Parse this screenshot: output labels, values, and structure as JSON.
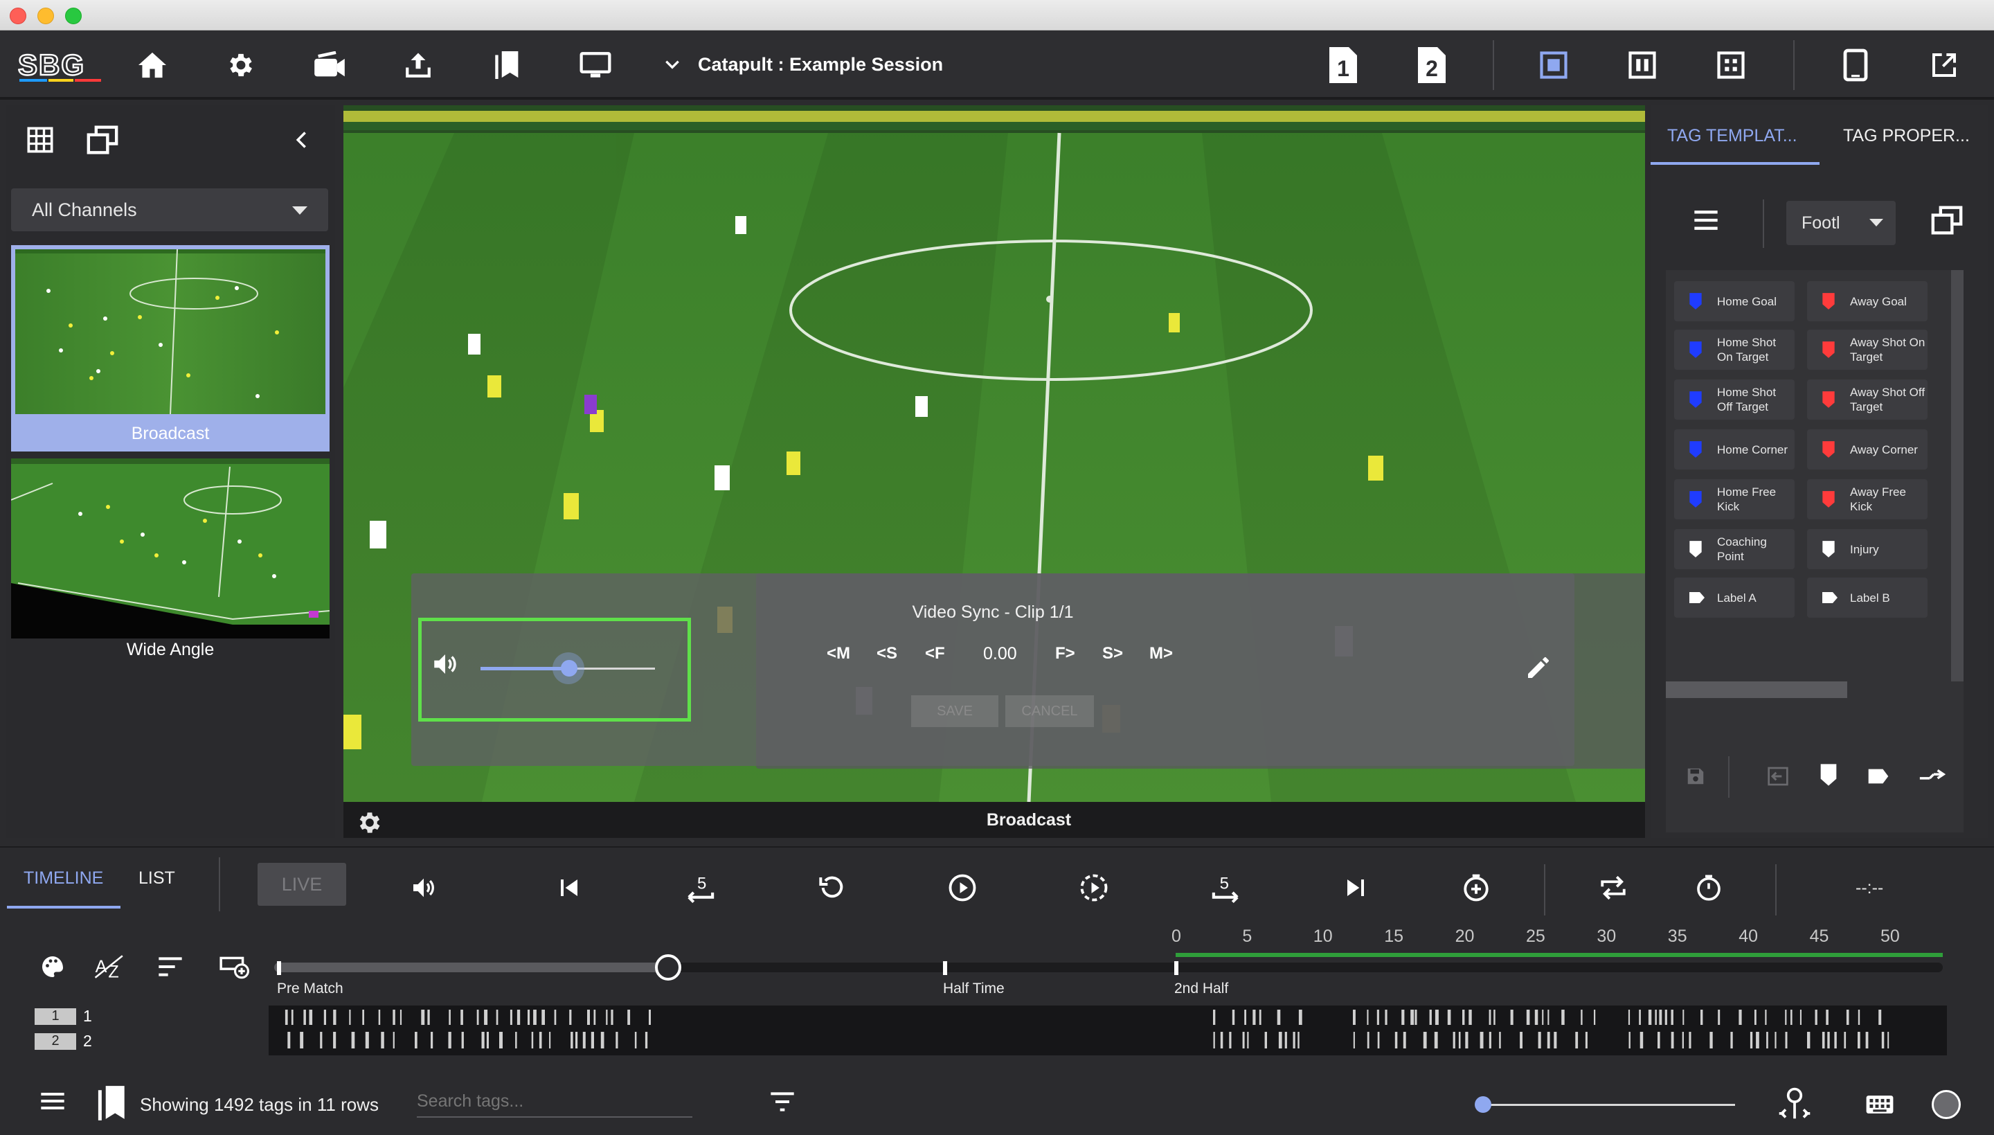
{
  "app": {
    "logo": "SBG",
    "session_title": "Catapult : Example Session"
  },
  "toolbar": {
    "icons": [
      "home-icon",
      "settings-icon",
      "camera-icon",
      "upload-icon",
      "bookmarks-icon",
      "monitor-icon"
    ],
    "view_badges": [
      "1",
      "2"
    ]
  },
  "left_panel": {
    "channel_select": "All Channels",
    "channels": [
      {
        "label": "Broadcast",
        "selected": true
      },
      {
        "label": "Wide Angle",
        "selected": false
      }
    ]
  },
  "video": {
    "sync_title": "Video Sync - Clip 1/1",
    "nudge_buttons": [
      "<M",
      "<S",
      "<F",
      "F>",
      "S>",
      "M>"
    ],
    "offset_value": "0.00",
    "save_label": "SAVE",
    "cancel_label": "CANCEL",
    "volume_level": 0.5,
    "channel_label": "Broadcast"
  },
  "right_panel": {
    "tabs": [
      "TAG TEMPLAT...",
      "TAG PROPER..."
    ],
    "active_tab": 0,
    "template_select": "Footl",
    "tags": [
      {
        "label": "Home Goal",
        "color": "#1f3cff"
      },
      {
        "label": "Away Goal",
        "color": "#ff3b3b"
      },
      {
        "label": "Home Shot On Target",
        "color": "#1f3cff"
      },
      {
        "label": "Away Shot On Target",
        "color": "#ff3b3b"
      },
      {
        "label": "Home Shot Off Target",
        "color": "#1f3cff"
      },
      {
        "label": "Away Shot Off Target",
        "color": "#ff3b3b"
      },
      {
        "label": "Home Corner",
        "color": "#1f3cff"
      },
      {
        "label": "Away Corner",
        "color": "#ff3b3b"
      },
      {
        "label": "Home Free Kick",
        "color": "#1f3cff"
      },
      {
        "label": "Away Free Kick",
        "color": "#ff3b3b"
      },
      {
        "label": "Coaching Point",
        "color": "#ffffff"
      },
      {
        "label": "Injury",
        "color": "#ffffff"
      },
      {
        "label": "Label A",
        "color": "#ffffff",
        "shape": "label"
      },
      {
        "label": "Label B",
        "color": "#ffffff",
        "shape": "label"
      }
    ]
  },
  "timeline": {
    "tabs": [
      "TIMELINE",
      "LIST"
    ],
    "active_tab": 0,
    "live_label": "LIVE",
    "skip_back_label": "5",
    "skip_forward_label": "5",
    "time_display": "--:--",
    "ticks": [
      "0",
      "5",
      "10",
      "15",
      "20",
      "25",
      "30",
      "35",
      "40",
      "45",
      "50"
    ],
    "periods": [
      "Pre Match",
      "Half Time",
      "2nd Half"
    ],
    "playhead_fraction": 0.24,
    "rows": [
      {
        "num": "1",
        "label": "1"
      },
      {
        "num": "2",
        "label": "2"
      }
    ]
  },
  "status": {
    "tag_count_text": "Showing 1492 tags in 11 rows",
    "search_placeholder": "Search tags...",
    "zoom_level": 0.0
  },
  "colors": {
    "accent": "#8fa8f0",
    "sync_highlight": "#5fe04a",
    "pitch": "#3f8a2c"
  }
}
